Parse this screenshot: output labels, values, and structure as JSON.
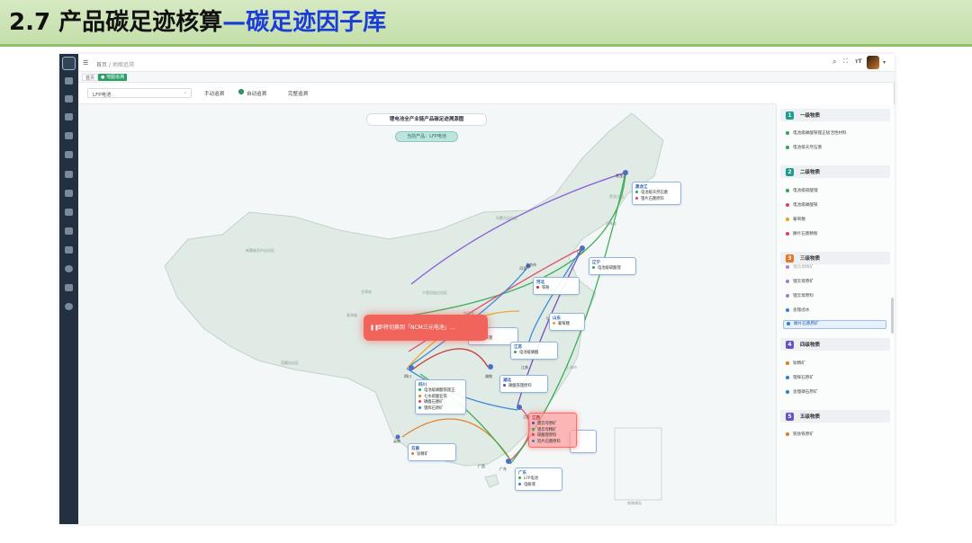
{
  "slide": {
    "title_prefix": "2.7 产品碳足迹核算",
    "title_highlight": "—碳足迹因子库"
  },
  "app": {
    "breadcrumb": {
      "home": "首页",
      "sep": "/",
      "current": "地图追溯"
    },
    "tabs": [
      {
        "label": "首页"
      },
      {
        "label": "● 地图追溯"
      }
    ],
    "toolbar": {
      "product_select": "LFP电池",
      "modes": [
        {
          "label": "手动追溯",
          "active": false
        },
        {
          "label": "自动追溯",
          "active": true
        },
        {
          "label": "完整追溯",
          "active": false
        }
      ]
    },
    "topbar_icons": [
      "search-icon",
      "fullscreen-icon",
      "font-size-icon",
      "user-avatar",
      "more-icon"
    ]
  },
  "map": {
    "title": "锂电池全产业链产品碳足迹溯源图",
    "subtitle": "当前产品：LFP电池",
    "toast": "即将切换到「NCM三元电池」...",
    "regions": [
      "新疆维吾尔自治区",
      "西藏自治区",
      "内蒙古自治区",
      "黑龙江省",
      "吉林省",
      "青海省",
      "甘肃省",
      "宁夏回族自治区",
      "陕西省",
      "上海市",
      "台湾省",
      "南海诸岛"
    ],
    "cities": [
      "黑龙江",
      "辽宁",
      "河北",
      "山东",
      "江苏",
      "湖南",
      "四川",
      "云南",
      "广东",
      "江西",
      "广西",
      "北京市"
    ],
    "cards": [
      {
        "name": "黑龙江",
        "items": [
          {
            "label": "电池级天然石墨",
            "color": "#2ea84a"
          },
          {
            "label": "锂片石墨原料",
            "color": "#e0405f"
          }
        ]
      },
      {
        "name": "辽宁",
        "items": [
          {
            "label": "电池级碳酸锂",
            "color": "#2ea84a"
          }
        ]
      },
      {
        "name": "河北",
        "items": [
          {
            "label": "铁粉",
            "color": "#c62828"
          }
        ]
      },
      {
        "name": "山东",
        "items": [
          {
            "label": "葡萄糖",
            "color": "#e8a21a"
          }
        ]
      },
      {
        "name": "湖南",
        "items": [
          {
            "label": "磷酸铁锂",
            "color": "#e0405f"
          }
        ]
      },
      {
        "name": "江苏",
        "items": [
          {
            "label": "电池级磷酸",
            "color": "#2ea84a"
          }
        ]
      },
      {
        "name": "湖北",
        "items": [
          {
            "label": "磷酸铁锂原料",
            "color": "#6a3fb0"
          }
        ]
      },
      {
        "name": "四川",
        "items": [
          {
            "label": "电池级磷酸铁锂正",
            "color": "#2ea84a"
          },
          {
            "label": "七水硫酸亚铁",
            "color": "#e07a1a"
          },
          {
            "label": "磷酸石墨矿",
            "color": "#e0405f"
          },
          {
            "label": "锂辉石原矿",
            "color": "#2a7fd4"
          }
        ]
      },
      {
        "name": "江西",
        "items": [
          {
            "label": "锂云母原矿",
            "color": "#6a3fb0"
          },
          {
            "label": "锂云母精矿",
            "color": "#2ea84a"
          },
          {
            "label": "碳酸锂原料",
            "color": "#e0405f"
          },
          {
            "label": "铝片石墨原料",
            "color": "#2a7fd4"
          }
        ]
      },
      {
        "name": "云南",
        "items": [
          {
            "label": "钛精矿",
            "color": "#e07a1a"
          }
        ]
      },
      {
        "name": "广东",
        "items": [
          {
            "label": "LFP电池",
            "color": "#2ea84a"
          },
          {
            "label": "电解液",
            "color": "#2a7fd4"
          }
        ]
      }
    ]
  },
  "sidebar": {
    "tiers": [
      {
        "num": "1",
        "label": "一级物质",
        "color": "#1f9c8f",
        "items": [
          {
            "label": "电池级磷酸铁锂正极活性材料",
            "color": "#2ea84a"
          },
          {
            "label": "电池级天然石墨",
            "color": "#2ea84a"
          }
        ]
      },
      {
        "num": "2",
        "label": "二级物质",
        "color": "#1f9c8f",
        "items": [
          {
            "label": "电池级碳酸锂",
            "color": "#2ea84a"
          },
          {
            "label": "电池级磷酸铁",
            "color": "#e0405f"
          },
          {
            "label": "葡萄糖",
            "color": "#e8a21a"
          },
          {
            "label": "鳞片石墨精粉",
            "color": "#e0405f"
          }
        ]
      },
      {
        "num": "3",
        "label": "三级物质",
        "color": "#e07a2a",
        "items": [
          {
            "label": "锂云母精矿",
            "color": "#b57bd6"
          },
          {
            "label": "锂云母原矿",
            "color": "#9b7bd6"
          },
          {
            "label": "锂云母原料",
            "color": "#9b7bd6"
          },
          {
            "label": "含锂卤水",
            "color": "#2a7fd4"
          },
          {
            "label": "鳞片石墨原矿",
            "color": "#2a7fd4"
          }
        ]
      },
      {
        "num": "4",
        "label": "四级物质",
        "color": "#6a4fc7",
        "items": [
          {
            "label": "钛精矿",
            "color": "#e07a1a"
          },
          {
            "label": "锂辉石原矿",
            "color": "#2a7fd4"
          },
          {
            "label": "含锂磷石原矿",
            "color": "#2a7fd4"
          }
        ]
      },
      {
        "num": "5",
        "label": "五级物质",
        "color": "#6a4fc7",
        "items": [
          {
            "label": "钒钛铁原矿",
            "color": "#e07a1a"
          }
        ]
      }
    ],
    "active_item": "鳞片石墨原矿"
  }
}
